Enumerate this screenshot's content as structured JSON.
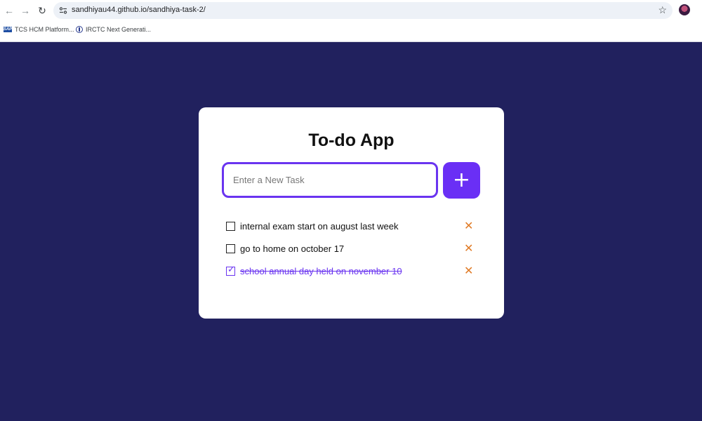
{
  "browser": {
    "url": "sandhiyau44.github.io/sandhiya-task-2/",
    "bookmarks": [
      {
        "label": "TCS HCM Platform...",
        "icon": "sap-icon"
      },
      {
        "label": "IRCTC Next Generati...",
        "icon": "irctc-icon"
      }
    ]
  },
  "app": {
    "title": "To-do App",
    "input_placeholder": "Enter a New Task",
    "input_value": "",
    "add_label": "+",
    "delete_label": "✕",
    "accent_color": "#6a2ff5",
    "delete_color": "#e07b26",
    "background_color": "#21215e",
    "tasks": [
      {
        "text": "internal exam start on august last week",
        "done": false
      },
      {
        "text": "go to home on october 17",
        "done": false
      },
      {
        "text": "school annual day held on november 10",
        "done": true
      }
    ]
  }
}
